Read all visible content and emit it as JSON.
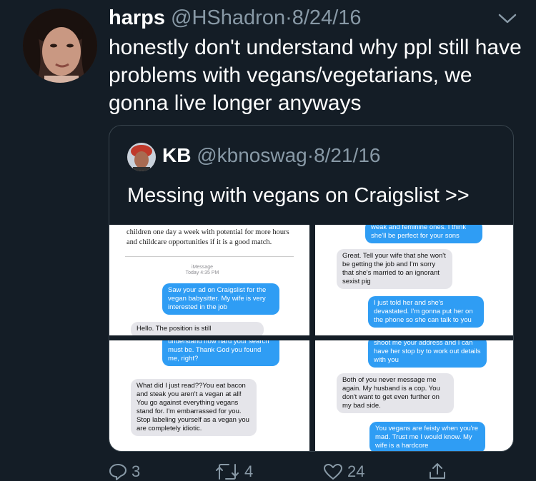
{
  "tweet": {
    "display_name": "harps",
    "handle": "@HShadron",
    "separator": "·",
    "date": "8/24/16",
    "text": "honestly don't understand why ppl still have problems with vegans/vegetarians, we gonna live longer anyways"
  },
  "quoted": {
    "display_name": "KB",
    "handle": "@kbnoswag",
    "separator": "·",
    "date": "8/21/16",
    "text": "Messing with vegans on Craigslist >>"
  },
  "screenshots": {
    "tl": {
      "doc_line1": "children one day a week with potential for more hours",
      "doc_line2": "and childcare opportunities if it is a good match.",
      "imessage_label": "iMessage",
      "timestamp": "Today 4:35 PM",
      "msg_blue": "Saw your ad on Craigslist for the vegan babysitter. My wife is very interested in the job",
      "msg_grey": "Hello. The position is still"
    },
    "tr": {
      "msg_blue_top": "weak and feminine ones. I think she'll be perfect for your sons",
      "msg_grey": "Great.  Tell your wife that she won't be getting the job and I'm sorry that she's married to an ignorant sexist pig",
      "msg_blue": "I just told her and she's devastated. I'm gonna put her on the phone so she can talk to you"
    },
    "bl": {
      "msg_blue_top": "understand how hard your search must be. Thank God you found me, right?",
      "msg_grey": "What did I just read??You eat bacon and steak you aren't a vegan at all! You go against everything vegans stand for. I'm embarrassed for you. Stop labeling yourself as a vegan you are completely idiotic."
    },
    "br": {
      "msg_blue_top": "shoot me your address and I can have her stop by to work out details with you",
      "msg_grey": "Both of you never message me again. My husband is a cop. You don't want to get even further on my bad side.",
      "msg_blue": "You vegans are feisty when you're mad. Trust me I would know. My wife is a hardcore"
    }
  },
  "actions": {
    "replies": "3",
    "retweets": "4",
    "likes": "24"
  },
  "colors": {
    "background": "#141d26",
    "muted": "#8899a6",
    "imessage_blue": "#2f9df4",
    "bubble_grey": "#e5e5ea"
  }
}
